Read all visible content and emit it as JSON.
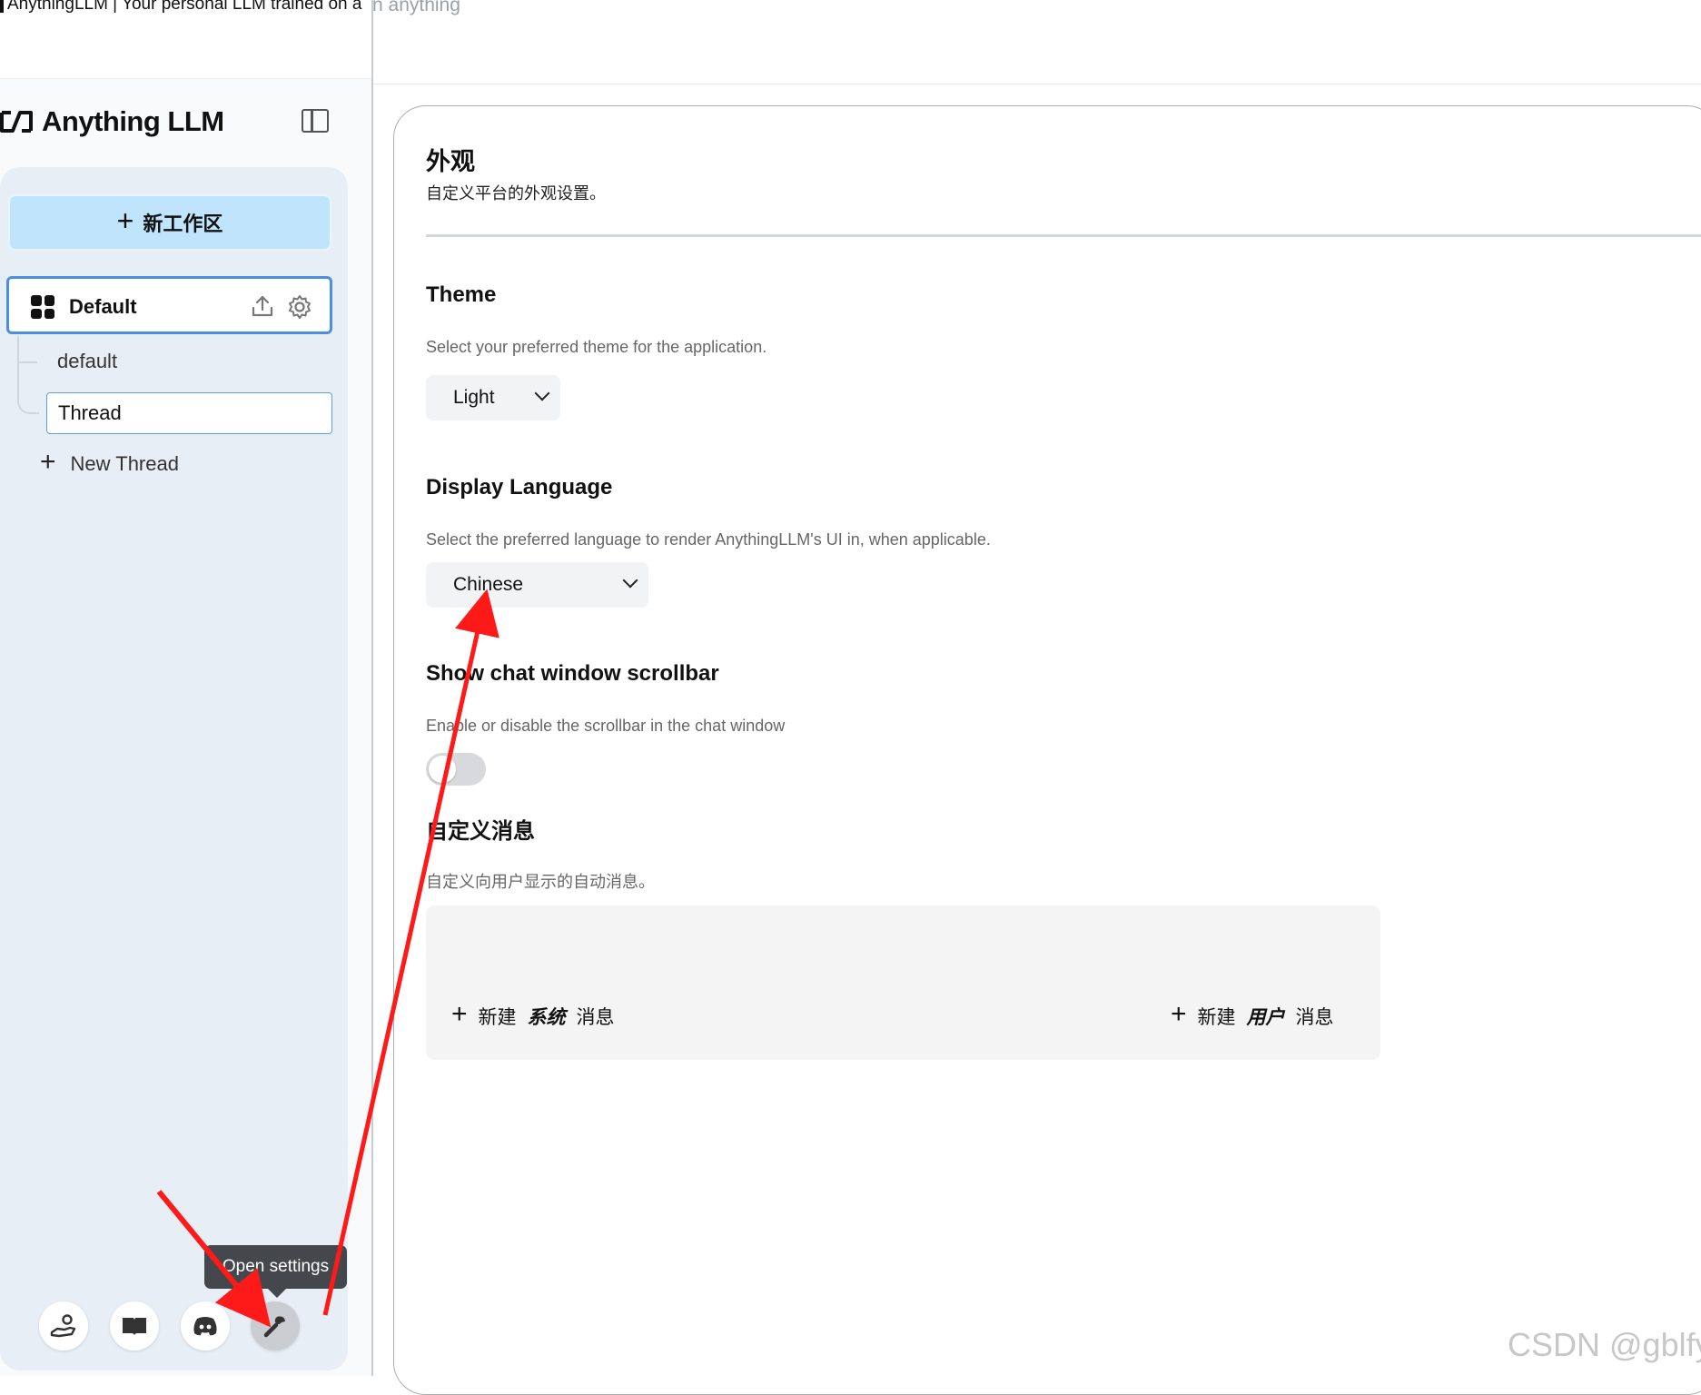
{
  "window": {
    "title": "AnythingLLM | Your personal LLM trained on a",
    "background_text": "n anything"
  },
  "sidebar": {
    "brand": "Anything LLM",
    "new_workspace_label": "新工作区",
    "workspace": {
      "name": "Default"
    },
    "threads": [
      {
        "label": "default"
      },
      {
        "label": "Thread"
      }
    ],
    "new_thread_label": "New Thread",
    "tooltip": "Open settings",
    "footer_icons": [
      "community-hub-icon",
      "docs-book-icon",
      "discord-icon",
      "settings-wrench-icon"
    ]
  },
  "main": {
    "title": "外观",
    "subtitle": "自定义平台的外观设置。",
    "theme": {
      "title": "Theme",
      "description": "Select your preferred theme for the application.",
      "value": "Light"
    },
    "language": {
      "title": "Display Language",
      "description": "Select the preferred language to render AnythingLLM's UI in, when applicable.",
      "value": "Chinese"
    },
    "scrollbar": {
      "title": "Show chat window scrollbar",
      "description": "Enable or disable the scrollbar in the chat window",
      "enabled": false
    },
    "custom_messages": {
      "title": "自定义消息",
      "description": "自定义向用户显示的自动消息。",
      "new_system": {
        "prefix": "新建",
        "emph": "系统",
        "suffix": "消息"
      },
      "new_user": {
        "prefix": "新建",
        "emph": "用户",
        "suffix": "消息"
      }
    }
  },
  "watermark": "CSDN @gblfy",
  "colors": {
    "accent_blue": "#4a90e2",
    "new_workspace_bg": "#bfe4fb",
    "annotation_arrow": "#ff1a1a"
  }
}
